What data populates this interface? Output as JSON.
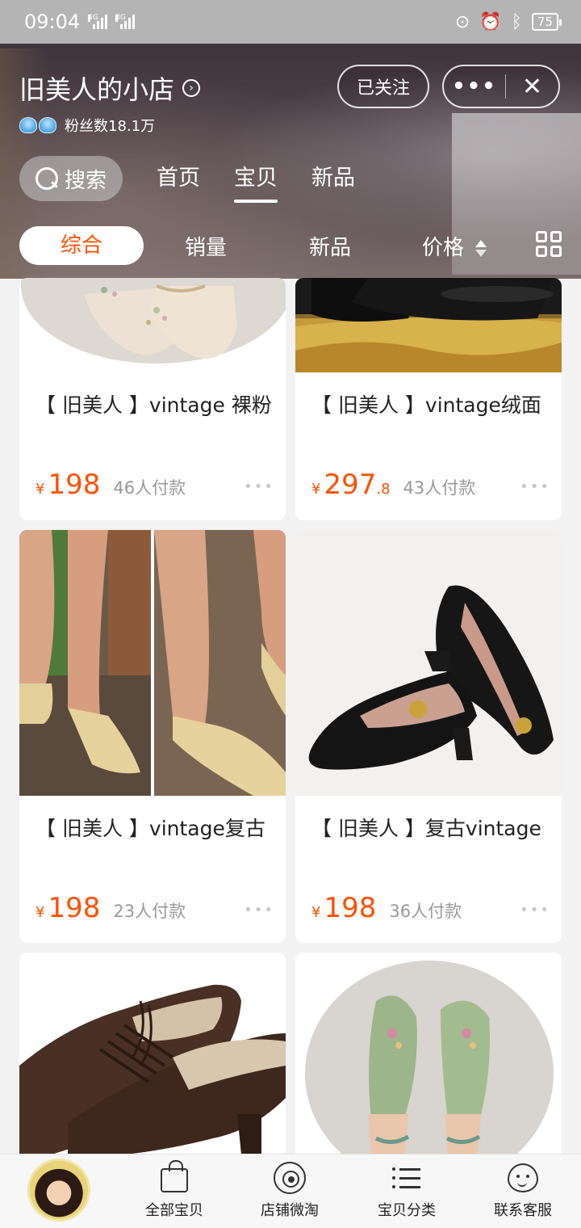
{
  "status_bar": {
    "time": "09:04",
    "network_1": "4G",
    "network_2": "3G",
    "battery": "75"
  },
  "shop": {
    "name": "旧美人的小店",
    "fans_label": "粉丝数18.1万",
    "follow_label": "已关注",
    "more_label": "•••",
    "close_label": "✕"
  },
  "nav": {
    "search_label": "搜索",
    "tabs": [
      "首页",
      "宝贝",
      "新品"
    ],
    "active_tab": "宝贝"
  },
  "sort": {
    "items": [
      "综合",
      "销量",
      "新品",
      "价格"
    ],
    "active": "综合"
  },
  "products": [
    {
      "title": "【 旧美人 】vintage 裸粉",
      "currency": "¥",
      "price_int": "198",
      "price_dec": "",
      "sold": "46人付款"
    },
    {
      "title": "【 旧美人 】vintage绒面",
      "currency": "¥",
      "price_int": "297",
      "price_dec": ".8",
      "sold": "43人付款"
    },
    {
      "title": "【 旧美人 】vintage复古",
      "currency": "¥",
      "price_int": "198",
      "price_dec": "",
      "sold": "23人付款"
    },
    {
      "title": "【 旧美人 】复古vintage",
      "currency": "¥",
      "price_int": "198",
      "price_dec": "",
      "sold": "36人付款"
    }
  ],
  "more_dots": "•••",
  "tabbar": {
    "items": [
      {
        "label": "全部宝贝",
        "icon": "bag-icon"
      },
      {
        "label": "店铺微淘",
        "icon": "broadcast-icon"
      },
      {
        "label": "宝贝分类",
        "icon": "list-icon"
      },
      {
        "label": "联系客服",
        "icon": "customer-service-icon"
      }
    ]
  },
  "colors": {
    "accent": "#ff5000",
    "muted": "#999999",
    "background": "#f2f2f2"
  }
}
